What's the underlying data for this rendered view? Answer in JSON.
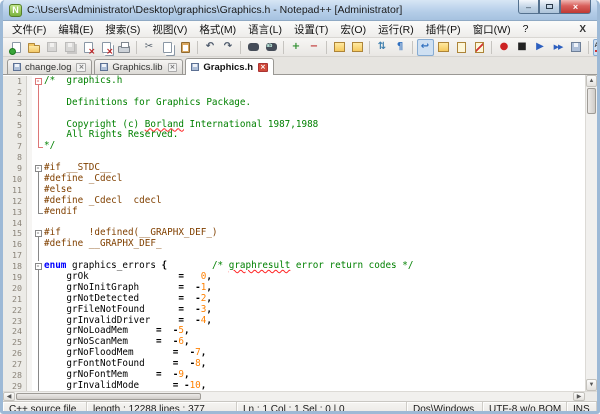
{
  "window": {
    "title": "C:\\Users\\Administrator\\Desktop\\graphics\\Graphics.h - Notepad++ [Administrator]",
    "app_initial": "N",
    "buttons": {
      "minimize": "–",
      "maximize": "",
      "close": "×"
    }
  },
  "colors": {
    "comment": "#008000",
    "preprocessor": "#804000",
    "keyword": "#0000ff",
    "number": "#ff8000",
    "fold_red": "#dd7777",
    "fold_gray": "#888888",
    "titlebar": "#b4cde8",
    "close_button": "#c03934"
  },
  "menu": {
    "items": [
      "文件(F)",
      "编辑(E)",
      "搜索(S)",
      "视图(V)",
      "格式(M)",
      "语言(L)",
      "设置(T)",
      "宏(O)",
      "运行(R)",
      "插件(P)",
      "窗口(W)",
      "?"
    ],
    "doc_close": "X"
  },
  "toolbar": {
    "items": [
      {
        "name": "new-file-icon",
        "k": "pg gd"
      },
      {
        "name": "open-folder-icon",
        "k": "folder"
      },
      {
        "name": "save-icon",
        "k": "floppy",
        "disabled": true
      },
      {
        "name": "save-all-icon",
        "k": "floppy dbl",
        "disabled": true
      },
      {
        "name": "close-file-icon",
        "k": "pg rx"
      },
      {
        "name": "close-all-icon",
        "k": "pg rx dbl"
      },
      {
        "name": "print-icon",
        "k": "printer"
      },
      {
        "sep": true
      },
      {
        "name": "cut-icon",
        "g": "✂",
        "c": "#5a6470"
      },
      {
        "name": "copy-icon",
        "k": "pg dbl"
      },
      {
        "name": "paste-icon",
        "k": "clip"
      },
      {
        "sep": true
      },
      {
        "name": "undo-icon",
        "g": "↶",
        "c": "#4a5668"
      },
      {
        "name": "redo-icon",
        "g": "↷",
        "c": "#4a5668"
      },
      {
        "sep": true
      },
      {
        "name": "find-icon",
        "k": "blob"
      },
      {
        "name": "replace-icon",
        "k": "blob rep"
      },
      {
        "sep": true
      },
      {
        "name": "zoom-in-icon",
        "g": "+",
        "c": "#2f8f2f"
      },
      {
        "name": "zoom-out-icon",
        "g": "−",
        "c": "#c23b3b"
      },
      {
        "sep": true
      },
      {
        "name": "restore-recent-icon",
        "k": "ysq"
      },
      {
        "name": "open-session-icon",
        "k": "ysq"
      },
      {
        "sep": true
      },
      {
        "name": "sync-scroll-icon",
        "g": "⇅",
        "c": "#3f7fae"
      },
      {
        "name": "show-all-chars-icon",
        "g": "¶",
        "c": "#2f6fbf"
      },
      {
        "sep": true
      },
      {
        "name": "word-wrap-icon",
        "g": "↩",
        "c": "#2f6fbf",
        "pressed": true
      },
      {
        "name": "doc-map-icon",
        "k": "ysq"
      },
      {
        "name": "function-list-icon",
        "k": "ypg"
      },
      {
        "name": "monitoring-icon",
        "k": "ypg mon"
      },
      {
        "sep": true
      },
      {
        "name": "macro-record-icon",
        "g": "●",
        "c": "#cc2222"
      },
      {
        "name": "macro-stop-icon",
        "g": "■",
        "c": "#222222"
      },
      {
        "name": "macro-play-icon",
        "g": "▶",
        "c": "#2d5fbf"
      },
      {
        "name": "macro-run-multiple-icon",
        "g": "▶▶",
        "c": "#2d5fbf",
        "small": true
      },
      {
        "name": "macro-save-icon",
        "k": "floppy"
      },
      {
        "sep": true
      },
      {
        "name": "spell-check-abc-icon",
        "k": "abc",
        "t": "ABC",
        "pressed": true
      },
      {
        "name": "doc-switcher-icon",
        "k": "pg"
      }
    ]
  },
  "tabs": [
    {
      "label": "change.log",
      "active": false
    },
    {
      "label": "Graphics.lib",
      "active": false
    },
    {
      "label": "Graphics.h",
      "active": true
    }
  ],
  "editor": {
    "lines": [
      {
        "n": 1,
        "f": "s",
        "c": "r",
        "s": [
          [
            "/*  graphics.h",
            "com"
          ]
        ]
      },
      {
        "n": 2,
        "f": "m",
        "c": "r",
        "s": []
      },
      {
        "n": 3,
        "f": "m",
        "c": "r",
        "s": [
          [
            "    Definitions for Graphics Package.",
            "com"
          ]
        ]
      },
      {
        "n": 4,
        "f": "m",
        "c": "r",
        "s": []
      },
      {
        "n": 5,
        "f": "m",
        "c": "r",
        "s": [
          [
            "    Copyright (c) ",
            "com"
          ],
          [
            "Borland",
            "com misp"
          ],
          [
            " International 1987,1988",
            "com"
          ]
        ]
      },
      {
        "n": 6,
        "f": "m",
        "c": "r",
        "s": [
          [
            "    All Rights Reserved.",
            "com"
          ]
        ]
      },
      {
        "n": 7,
        "f": "e",
        "c": "r",
        "s": [
          [
            "*/",
            "com"
          ]
        ]
      },
      {
        "n": 8,
        "f": "",
        "c": "g",
        "s": []
      },
      {
        "n": 9,
        "f": "s",
        "c": "g",
        "s": [
          [
            "#if __STDC__",
            "pre"
          ]
        ]
      },
      {
        "n": 10,
        "f": "m",
        "c": "g",
        "s": [
          [
            "#define _Cdecl",
            "pre"
          ]
        ]
      },
      {
        "n": 11,
        "f": "m",
        "c": "g",
        "s": [
          [
            "#else",
            "pre"
          ]
        ]
      },
      {
        "n": 12,
        "f": "m",
        "c": "g",
        "s": [
          [
            "#define _Cdecl  cdecl",
            "pre"
          ]
        ]
      },
      {
        "n": 13,
        "f": "e",
        "c": "g",
        "s": [
          [
            "#endif",
            "pre"
          ]
        ]
      },
      {
        "n": 14,
        "f": "",
        "c": "g",
        "s": []
      },
      {
        "n": 15,
        "f": "s",
        "c": "g",
        "s": [
          [
            "#if     !defined(__GRAPHX_DEF_)",
            "pre"
          ]
        ]
      },
      {
        "n": 16,
        "f": "m",
        "c": "g",
        "s": [
          [
            "#define __GRAPHX_DEF_",
            "pre"
          ]
        ]
      },
      {
        "n": 17,
        "f": "m",
        "c": "g",
        "s": []
      },
      {
        "n": 18,
        "f": "s",
        "c": "g",
        "s": [
          [
            "enum",
            "kw"
          ],
          [
            " graphics_errors ",
            "id"
          ],
          [
            "{",
            "op"
          ],
          [
            "        ",
            "id"
          ],
          [
            "/* ",
            "com"
          ],
          [
            "graphresult",
            "com misp"
          ],
          [
            " error return codes */",
            "com"
          ]
        ]
      },
      {
        "n": 19,
        "f": "m",
        "c": "g",
        "s": [
          [
            "    grOk                ",
            "id"
          ],
          [
            "=",
            "op"
          ],
          [
            "   ",
            "id"
          ],
          [
            "0",
            "num"
          ],
          [
            ",",
            "op"
          ]
        ]
      },
      {
        "n": 20,
        "f": "m",
        "c": "g",
        "s": [
          [
            "    grNoInitGraph       ",
            "id"
          ],
          [
            "=",
            "op"
          ],
          [
            "  ",
            "id"
          ],
          [
            "-",
            "op"
          ],
          [
            "1",
            "num"
          ],
          [
            ",",
            "op"
          ]
        ]
      },
      {
        "n": 21,
        "f": "m",
        "c": "g",
        "s": [
          [
            "    grNotDetected       ",
            "id"
          ],
          [
            "=",
            "op"
          ],
          [
            "  ",
            "id"
          ],
          [
            "-",
            "op"
          ],
          [
            "2",
            "num"
          ],
          [
            ",",
            "op"
          ]
        ]
      },
      {
        "n": 22,
        "f": "m",
        "c": "g",
        "s": [
          [
            "    grFileNotFound      ",
            "id"
          ],
          [
            "=",
            "op"
          ],
          [
            "  ",
            "id"
          ],
          [
            "-",
            "op"
          ],
          [
            "3",
            "num"
          ],
          [
            ",",
            "op"
          ]
        ]
      },
      {
        "n": 23,
        "f": "m",
        "c": "g",
        "s": [
          [
            "    grInvalidDriver     ",
            "id"
          ],
          [
            "=",
            "op"
          ],
          [
            "  ",
            "id"
          ],
          [
            "-",
            "op"
          ],
          [
            "4",
            "num"
          ],
          [
            ",",
            "op"
          ]
        ]
      },
      {
        "n": 24,
        "f": "m",
        "c": "g",
        "s": [
          [
            "    grNoLoadMem     ",
            "id"
          ],
          [
            "=",
            "op"
          ],
          [
            "  ",
            "id"
          ],
          [
            "-",
            "op"
          ],
          [
            "5",
            "num"
          ],
          [
            ",",
            "op"
          ]
        ]
      },
      {
        "n": 25,
        "f": "m",
        "c": "g",
        "s": [
          [
            "    grNoScanMem     ",
            "id"
          ],
          [
            "=",
            "op"
          ],
          [
            "  ",
            "id"
          ],
          [
            "-",
            "op"
          ],
          [
            "6",
            "num"
          ],
          [
            ",",
            "op"
          ]
        ]
      },
      {
        "n": 26,
        "f": "m",
        "c": "g",
        "s": [
          [
            "    grNoFloodMem       ",
            "id"
          ],
          [
            "=",
            "op"
          ],
          [
            "  ",
            "id"
          ],
          [
            "-",
            "op"
          ],
          [
            "7",
            "num"
          ],
          [
            ",",
            "op"
          ]
        ]
      },
      {
        "n": 27,
        "f": "m",
        "c": "g",
        "s": [
          [
            "    grFontNotFound     ",
            "id"
          ],
          [
            "=",
            "op"
          ],
          [
            "  ",
            "id"
          ],
          [
            "-",
            "op"
          ],
          [
            "8",
            "num"
          ],
          [
            ",",
            "op"
          ]
        ]
      },
      {
        "n": 28,
        "f": "m",
        "c": "g",
        "s": [
          [
            "    grNoFontMem     ",
            "id"
          ],
          [
            "=",
            "op"
          ],
          [
            "  ",
            "id"
          ],
          [
            "-",
            "op"
          ],
          [
            "9",
            "num"
          ],
          [
            ",",
            "op"
          ]
        ]
      },
      {
        "n": 29,
        "f": "m",
        "c": "g",
        "s": [
          [
            "    grInvalidMode      ",
            "id"
          ],
          [
            "=",
            "op"
          ],
          [
            " ",
            "id"
          ],
          [
            "-",
            "op"
          ],
          [
            "10",
            "num"
          ],
          [
            ",",
            "op"
          ]
        ]
      }
    ]
  },
  "status": {
    "sections": [
      {
        "name": "doc-type",
        "text": "C++ source file",
        "w": 0
      },
      {
        "name": "doc-size",
        "text": "length : 12288    lines : 377",
        "w": 150
      },
      {
        "name": "cursor-pos",
        "text": "Ln : 1    Col : 1    Sel : 0 | 0",
        "w": 170
      },
      {
        "name": "eol-format",
        "text": "Dos\\Windows",
        "w": 76
      },
      {
        "name": "encoding",
        "text": "UTF-8 w/o BOM",
        "w": 84
      },
      {
        "name": "insert-mode",
        "text": "INS",
        "w": 30
      }
    ]
  }
}
